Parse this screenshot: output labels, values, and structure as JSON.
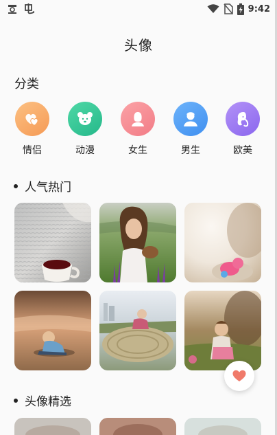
{
  "status_bar": {
    "time": "9:42"
  },
  "header": {
    "title": "头像"
  },
  "categories": {
    "heading": "分类",
    "items": [
      {
        "label": "情侣",
        "icon": "couple-icon",
        "color": "#f9a564"
      },
      {
        "label": "动漫",
        "icon": "anime-icon",
        "color": "#35c79a"
      },
      {
        "label": "女生",
        "icon": "girl-icon",
        "color": "#f58c93"
      },
      {
        "label": "男生",
        "icon": "boy-icon",
        "color": "#4f9ff5"
      },
      {
        "label": "欧美",
        "icon": "western-icon",
        "color": "#9b78f0"
      }
    ]
  },
  "sections": [
    {
      "title": "人气热门"
    },
    {
      "title": "头像精选"
    }
  ],
  "colors": {
    "accent_heart": "#f07a6a"
  }
}
